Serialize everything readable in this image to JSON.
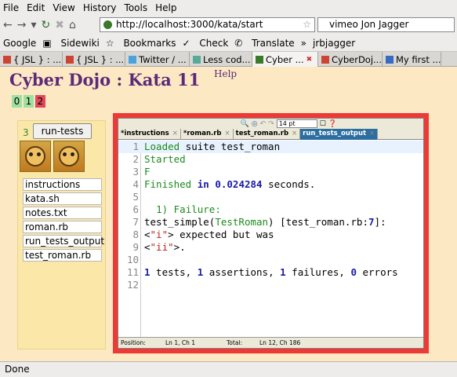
{
  "menu": [
    "File",
    "Edit",
    "View",
    "History",
    "Tools",
    "Help"
  ],
  "nav": {
    "url": "http://localhost:3000/kata/start",
    "search": "vimeo Jon Jagger"
  },
  "bookmarks": [
    "Google",
    "Sidewiki",
    "Bookmarks",
    "Check",
    "Translate",
    "»",
    "jrbjagger"
  ],
  "tabs": [
    {
      "label": "{ JSL } : ...",
      "active": false
    },
    {
      "label": "{ JSL } : ...",
      "active": false
    },
    {
      "label": "Twitter / ...",
      "active": false
    },
    {
      "label": "Less cod...",
      "active": false
    },
    {
      "label": "Cyber ...",
      "active": true
    },
    {
      "label": "CyberDoj...",
      "active": false
    },
    {
      "label": "My first ...",
      "active": false
    }
  ],
  "page": {
    "title": "Cyber Dojo : Kata 11",
    "help": "Help",
    "counts": [
      {
        "value": "0",
        "color": "#9fe0a0"
      },
      {
        "value": "1",
        "color": "#9fe0a0"
      },
      {
        "value": "2",
        "color": "#e0485a"
      }
    ],
    "run_count": "3",
    "run_tests": "run-tests",
    "files": [
      "instructions",
      "kata.sh",
      "notes.txt",
      "roman.rb",
      "run_tests_output",
      "test_roman.rb"
    ]
  },
  "editor": {
    "font_size": "14 pt",
    "tabs": [
      {
        "label": "*instructions",
        "active": false
      },
      {
        "label": "*roman.rb",
        "active": false
      },
      {
        "label": "test_roman.rb",
        "active": false
      },
      {
        "label": "run_tests_output",
        "active": true
      }
    ],
    "lines": [
      "Loaded suite test_roman",
      "Started",
      "F",
      "Finished in 0.024284 seconds.",
      "",
      "  1) Failure:",
      "test_simple(TestRoman) [test_roman.rb:7]:",
      "<\"i\"> expected but was",
      "<\"ii\">.",
      "",
      "1 tests, 1 assertions, 1 failures, 0 errors",
      ""
    ],
    "status": {
      "position_label": "Position:",
      "position": "Ln 1, Ch 1",
      "total_label": "Total:",
      "total": "Ln 12, Ch 186"
    }
  },
  "status": "Done"
}
